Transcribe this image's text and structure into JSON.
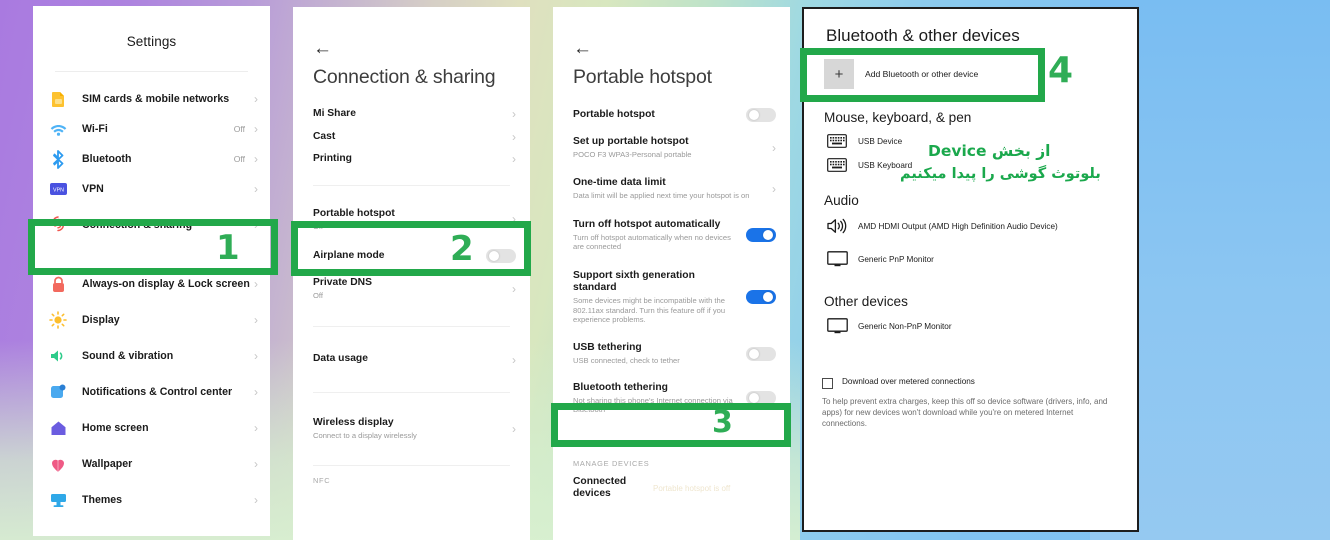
{
  "theme": {
    "accent_green": "#22a84a",
    "number_green": "#2fad56",
    "toggle_blue": "#1a73e8"
  },
  "panel1": {
    "name": "android-settings",
    "title": "Settings",
    "items": [
      {
        "icon": "sim-card-icon",
        "label": "SIM cards & mobile networks",
        "value": "",
        "chevron": "›"
      },
      {
        "icon": "wifi-icon",
        "label": "Wi-Fi",
        "value": "Off",
        "chevron": "›"
      },
      {
        "icon": "bluetooth-icon",
        "label": "Bluetooth",
        "value": "Off",
        "chevron": "›"
      },
      {
        "icon": "vpn-icon",
        "label": "VPN",
        "value": "",
        "chevron": "›"
      },
      {
        "icon": "connection-sharing-icon",
        "label": "Connection & sharing",
        "value": "",
        "chevron": "›"
      },
      {
        "icon": "lock-icon",
        "label": "Always-on display & Lock screen",
        "value": "",
        "chevron": "›"
      },
      {
        "icon": "brightness-icon",
        "label": "Display",
        "value": "",
        "chevron": "›"
      },
      {
        "icon": "speaker-icon",
        "label": "Sound & vibration",
        "value": "",
        "chevron": "›"
      },
      {
        "icon": "notifications-icon",
        "label": "Notifications & Control center",
        "value": "",
        "chevron": "›"
      },
      {
        "icon": "home-icon",
        "label": "Home screen",
        "value": "",
        "chevron": "›"
      },
      {
        "icon": "wallpaper-icon",
        "label": "Wallpaper",
        "value": "",
        "chevron": "›"
      },
      {
        "icon": "themes-icon",
        "label": "Themes",
        "value": "",
        "chevron": "›"
      }
    ]
  },
  "panel2": {
    "name": "connection-and-sharing",
    "back": "←",
    "title": "Connection & sharing",
    "items": [
      {
        "label": "Mi Share",
        "sub": "",
        "chevron": "›"
      },
      {
        "label": "Cast",
        "sub": "",
        "chevron": "›"
      },
      {
        "label": "Printing",
        "sub": "",
        "chevron": "›"
      },
      {
        "label": "Portable hotspot",
        "sub": "Off",
        "chevron": "›"
      },
      {
        "label": "Airplane mode",
        "sub": "",
        "toggle": "off"
      },
      {
        "label": "Private DNS",
        "sub": "Off",
        "chevron": "›"
      },
      {
        "label": "Data usage",
        "sub": "",
        "chevron": "›"
      },
      {
        "label": "Wireless display",
        "sub": "Connect to a display wirelessly",
        "chevron": "›"
      }
    ],
    "footer_group": "NFC"
  },
  "panel3": {
    "name": "portable-hotspot",
    "back": "←",
    "title": "Portable hotspot",
    "items": [
      {
        "label": "Portable hotspot",
        "sub": "",
        "toggle": "off"
      },
      {
        "label": "Set up portable hotspot",
        "sub": "POCO F3 WPA3-Personal portable",
        "chevron": "›"
      },
      {
        "label": "One-time data limit",
        "sub": "Data limit will be applied next time your hotspot is on",
        "chevron": "›"
      },
      {
        "label": "Turn off hotspot automatically",
        "sub": "Turn off hotspot automatically when no devices are connected",
        "toggle": "on"
      },
      {
        "label": "Support sixth generation standard",
        "sub": "Some devices might be incompatible with the 802.11ax standard. Turn this feature off if you experience problems.",
        "toggle": "on"
      },
      {
        "label": "USB tethering",
        "sub": "USB connected, check to tether",
        "toggle": "off"
      },
      {
        "label": "Bluetooth tethering",
        "sub": "Not sharing this phone's Internet connection via Bluetooth",
        "toggle": "off"
      }
    ],
    "group_label": "MANAGE DEVICES",
    "connected_devices_label": "Connected devices",
    "connected_devices_value": "Portable hotspot is off"
  },
  "panel4": {
    "name": "windows-bluetooth-settings",
    "title": "Bluetooth & other devices",
    "add_button_label": "Add Bluetooth or other device",
    "add_button_icon": "plus-icon",
    "sections": [
      {
        "heading": "Mouse, keyboard, & pen",
        "devices": [
          {
            "icon": "keyboard-icon",
            "label": "USB Device"
          },
          {
            "icon": "keyboard-icon",
            "label": "USB Keyboard"
          }
        ]
      },
      {
        "heading": "Audio",
        "devices": [
          {
            "icon": "speaker-wave-icon",
            "label": "AMD HDMI Output (AMD High Definition Audio Device)"
          },
          {
            "icon": "monitor-icon",
            "label": "Generic PnP Monitor"
          }
        ]
      },
      {
        "heading": "Other devices",
        "devices": [
          {
            "icon": "monitor-icon",
            "label": "Generic Non-PnP Monitor"
          }
        ]
      }
    ],
    "checkbox_label": "Download over metered connections",
    "checkbox_checked": false,
    "note": "To help prevent extra charges, keep this off so device software (drivers, info, and apps) for new devices won't download while you're on metered Internet connections."
  },
  "annotations": {
    "step1": "1",
    "step2": "2",
    "step3": "3",
    "step4": "4",
    "persian_line1": "از بخش Device",
    "persian_line2": "بلوتوث گوشی را پیدا میکنیم"
  }
}
